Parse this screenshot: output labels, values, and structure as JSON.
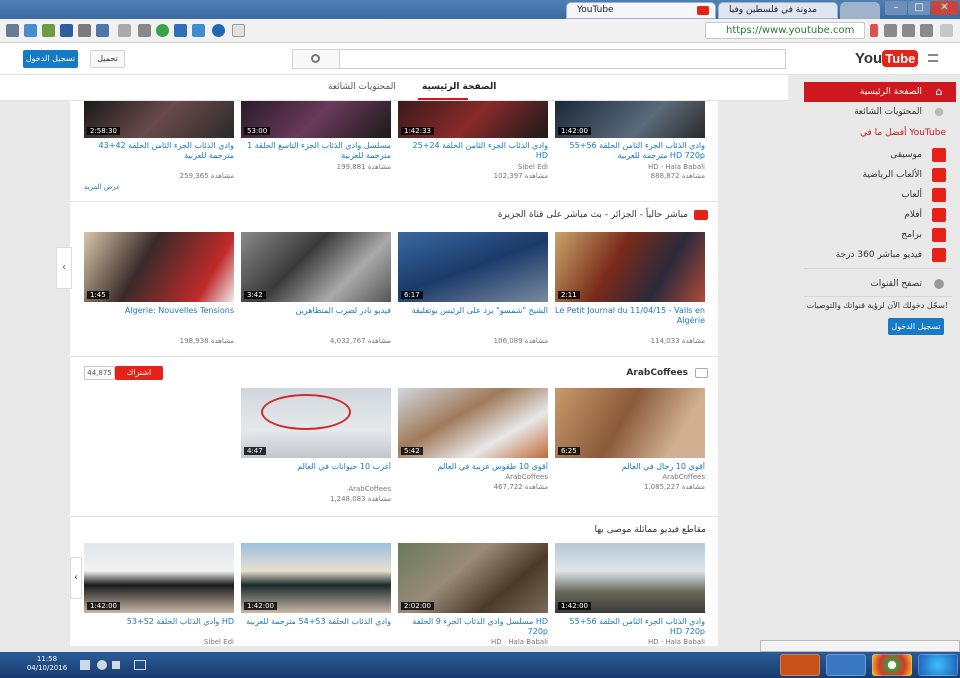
{
  "browser": {
    "tabs": [
      {
        "label": "YouTube",
        "active": true
      },
      {
        "label": "مدونة في فلسطين وفيا",
        "active": false
      },
      {
        "label": "",
        "active": false
      }
    ],
    "url": "https://www.youtube.com"
  },
  "header": {
    "upload_label": "تحميل",
    "signin_label": "تسجيل الدخول",
    "logo_text": "YouTube"
  },
  "subnav": {
    "home_tab": "الصفحة الرئيسية",
    "trending_tab": "المحتويات الشائعة"
  },
  "sidebar": {
    "items": [
      {
        "label": "الصفحة الرئيسية",
        "icon": "home-icon"
      },
      {
        "label": "المحتويات الشائعة",
        "icon": "trending-icon"
      }
    ],
    "section_title": "أفضل ما في YouTube",
    "categories": [
      {
        "label": "موسيقى",
        "icon": "music-icon"
      },
      {
        "label": "الألعاب الرياضية",
        "icon": "sports-icon"
      },
      {
        "label": "ألعاب",
        "icon": "gaming-icon"
      },
      {
        "label": "أفلام",
        "icon": "movies-icon"
      },
      {
        "label": "برامج",
        "icon": "tv-icon"
      },
      {
        "label": "فيديو مباشر 360 درجة",
        "icon": "video360-icon"
      }
    ],
    "browse_channels": "تصفح القنوات",
    "signin_prompt": "سجّل دخولك الآن لرؤية قنواتك والتوصيات!",
    "signin_button": "تسجيل الدخول",
    "colors": {
      "accent": "#cc181e",
      "link": "#167ac6"
    }
  },
  "shelves": [
    {
      "title": "",
      "videos": [
        {
          "title": "وادي الذئاب الجزء الثامن الحلقة 56+55 مترجمة للعربية HD 720p",
          "meta": "HD · Hala Babali",
          "views": "مشاهدة 888,872",
          "duration": "1:42:00"
        },
        {
          "title": "وادي الذئاب الجزء الثامن الحلقة 24+25 HD",
          "meta": "Sibel Edi",
          "views": "مشاهدة 102,397",
          "duration": "1:42:33"
        },
        {
          "title": "مسلسل وادي الذئاب الجزء التاسع الحلقة 1 مترجمة للعربية",
          "meta": "",
          "views": "مشاهدة 199,881",
          "duration": "53:00"
        },
        {
          "title": "وادي الذئاب الجزء الثامن الحلقة 42+43 مترجمة للعربية",
          "meta": "",
          "views": "مشاهدة 259,365",
          "duration": "2:58:30"
        }
      ],
      "more": "عرض المزيد"
    },
    {
      "title": "مباشر حالياً - الجزائر - بث مباشر على قناة الجزيرة",
      "videos": [
        {
          "title": "Le Petit Journal du 11/04/15 - Valls en Algérie",
          "meta": "",
          "views": "مشاهدة 114,033",
          "duration": "2:11"
        },
        {
          "title": "الشيخ \"شمسو\" يرد على الرئيس بوتفليقة",
          "meta": "",
          "views": "مشاهدة 106,089",
          "duration": "6:17"
        },
        {
          "title": "فيديو نادر لضرب المتظاهرين",
          "meta": "",
          "views": "مشاهدة 4,032,767",
          "duration": "3:42"
        },
        {
          "title": "Algerie: Nouvelles Tensions",
          "meta": "",
          "views": "مشاهدة 198,938",
          "duration": "1:45"
        }
      ]
    },
    {
      "title": "ArabCoffees",
      "subscribe_label": "اشتراك",
      "subscriber_count": "44,875",
      "videos": [
        {
          "title": "أقوى 10 رجال في العالم",
          "meta": "ArabCoffees",
          "views": "مشاهدة 1,085,227",
          "duration": "6:25"
        },
        {
          "title": "أقوى 10 طقوس غريبة في العالم",
          "meta": "ArabCoffees",
          "views": "مشاهدة 467,722",
          "duration": "5:42"
        },
        {
          "title": "أغرب 10 حيوانات في العالم",
          "meta": "ArabCoffees",
          "views": "مشاهدة 1,248,083",
          "duration": "4:47"
        }
      ]
    },
    {
      "title": "مقاطع فيديو مماثلة موصى بها",
      "videos": [
        {
          "title": "وادي الذئاب الجزء الثامن الحلقة 56+55 HD 720p",
          "meta": "HD · Hala Babali",
          "views": "",
          "duration": "1:42:00"
        },
        {
          "title": "مسلسل وادي الذئاب الجزء 9 الحلقة HD 720p",
          "meta": "HD · Hala Babali",
          "views": "",
          "duration": "2:02:00"
        },
        {
          "title": "وادي الذئاب الحلقة 53+54 مترجمة للعربية",
          "meta": "",
          "views": "",
          "duration": "1:42:00"
        },
        {
          "title": "وادي الذئاب الحلقة 52+53 HD",
          "meta": "Sibel Edi",
          "views": "",
          "duration": "1:42:00"
        }
      ]
    }
  ],
  "taskbar": {
    "time": "11:58",
    "date": "04/10/2016"
  }
}
